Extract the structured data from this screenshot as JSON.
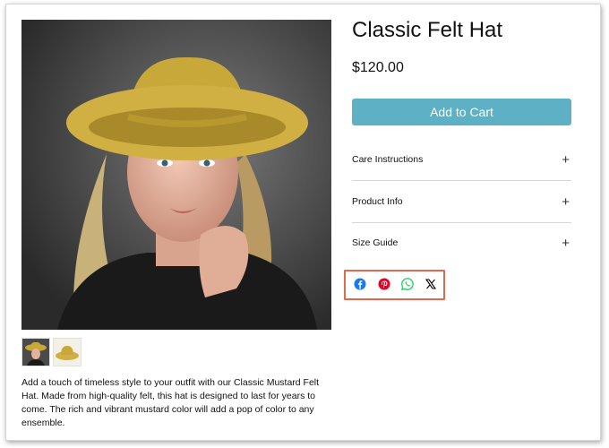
{
  "product": {
    "title": "Classic Felt Hat",
    "price": "$120.00",
    "add_to_cart_label": "Add to Cart",
    "description": "Add a touch of timeless style to your outfit with our Classic Mustard Felt Hat. Made from high-quality felt, this hat is designed to last for years to come. The rich and vibrant mustard color will add a pop of color to any ensemble."
  },
  "accordion": [
    {
      "label": "Care Instructions",
      "icon": "plus-icon"
    },
    {
      "label": "Product Info",
      "icon": "plus-icon"
    },
    {
      "label": "Size Guide",
      "icon": "plus-icon"
    }
  ],
  "share_icons": [
    "facebook-icon",
    "pinterest-icon",
    "whatsapp-icon",
    "x-icon"
  ],
  "colors": {
    "button": "#5eb0c4",
    "highlight_border": "#e06a4e",
    "facebook": "#1877f2",
    "pinterest": "#e60023",
    "whatsapp": "#25d366",
    "x": "#000000",
    "hat": "#c9a83a"
  }
}
